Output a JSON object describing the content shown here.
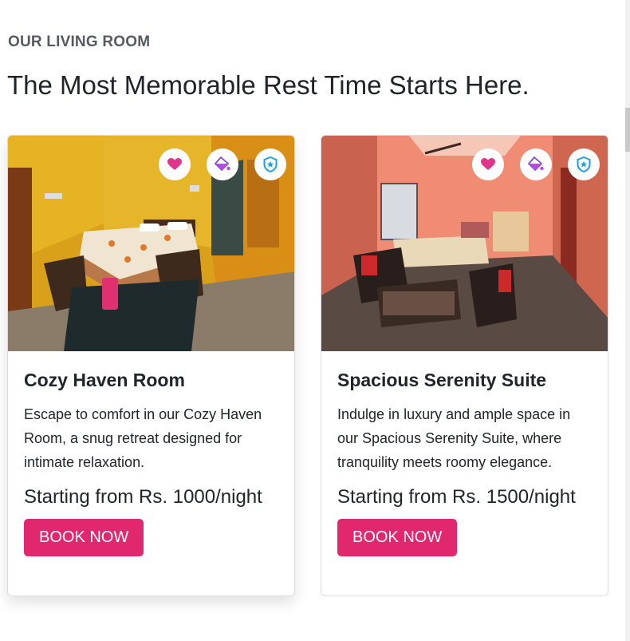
{
  "section": {
    "eyebrow": "OUR LIVING ROOM",
    "title": "The Most Memorable Rest Time Starts Here."
  },
  "rooms": [
    {
      "name": "Cozy Haven Room",
      "description": "Escape to comfort in our Cozy Haven Room, a snug retreat designed for intimate relaxation.",
      "price": "Starting from Rs. 1000/night",
      "cta": "BOOK NOW",
      "icons": [
        "heart-icon",
        "paint-bucket-icon",
        "shield-star-icon"
      ]
    },
    {
      "name": "Spacious Serenity Suite",
      "description": "Indulge in luxury and ample space in our Spacious Serenity Suite, where tranquility meets roomy elegance.",
      "price": "Starting from Rs. 1500/night",
      "cta": "BOOK NOW",
      "icons": [
        "heart-icon",
        "paint-bucket-icon",
        "shield-star-icon"
      ]
    }
  ],
  "colors": {
    "accent": "#e1286e",
    "heart_icon": "#e0368a",
    "paint_icon": "#b54ae6",
    "shield_icon": "#1aa3d9"
  }
}
